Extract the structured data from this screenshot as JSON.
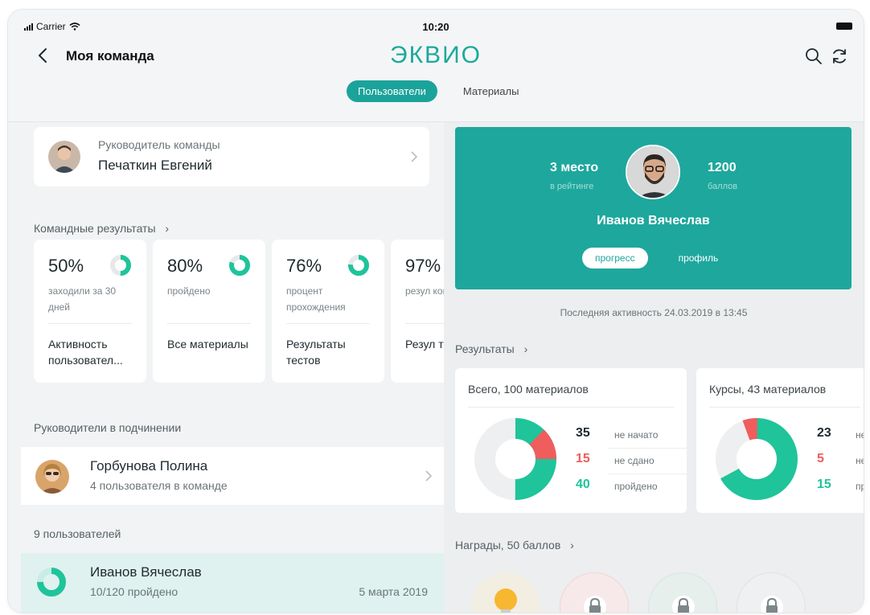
{
  "status": {
    "carrier": "Carrier",
    "time": "10:20"
  },
  "header": {
    "title": "Моя команда",
    "logo": "ЭКВИО",
    "tabs": [
      {
        "label": "Пользователи",
        "active": true
      },
      {
        "label": "Материалы",
        "active": false
      }
    ]
  },
  "lead": {
    "subtitle": "Руководитель команды",
    "name": "Печаткин Евгений"
  },
  "team_results": {
    "label": "Командные результаты",
    "cards": [
      {
        "value": "50%",
        "desc": "заходили за 30 дней",
        "title": "Активность пользовател..."
      },
      {
        "value": "80%",
        "desc": "пройдено",
        "title": "Все материалы"
      },
      {
        "value": "76%",
        "desc": "процент прохождения",
        "title": "Результаты тестов"
      },
      {
        "value": "97%",
        "desc": "резул коман",
        "title": "Резул тестов"
      }
    ]
  },
  "subordinates": {
    "label": "Руководители в подчинении",
    "item": {
      "name": "Горбунова Полина",
      "meta": "4 пользователя в команде"
    }
  },
  "users": {
    "count_label": "9 пользователей",
    "selected": {
      "name": "Иванов Вячеслав",
      "progress_text": "10/120 пройдено",
      "date": "5 марта 2019"
    }
  },
  "profile": {
    "rank_value": "3 место",
    "rank_caption": "в рейтинге",
    "points_value": "1200",
    "points_caption": "баллов",
    "name": "Иванов Вячеслав",
    "tabs": [
      {
        "label": "прогресс",
        "active": true
      },
      {
        "label": "профиль",
        "active": false
      }
    ],
    "last_activity": "Последняя активность 24.03.2019 в 13:45"
  },
  "results": {
    "label": "Результаты",
    "cards": [
      {
        "title": "Всего, 100 материалов",
        "rows": [
          {
            "num": "35",
            "label": "не начато",
            "color": "#1f2a2e"
          },
          {
            "num": "15",
            "label": "не сдано",
            "color": "#ef5d5d"
          },
          {
            "num": "40",
            "label": "пройдено",
            "color": "#1fc49a"
          }
        ]
      },
      {
        "title": "Курсы, 43 материалов",
        "rows": [
          {
            "num": "23",
            "label": "не",
            "color": "#1f2a2e"
          },
          {
            "num": "5",
            "label": "не",
            "color": "#ef5d5d"
          },
          {
            "num": "15",
            "label": "пр",
            "color": "#1fc49a"
          }
        ]
      }
    ]
  },
  "awards": {
    "label": "Награды, 50 баллов"
  },
  "colors": {
    "accent": "#1aa39a",
    "green": "#1fc49a",
    "red": "#ef5d5d",
    "selected_row": "#dff2f0"
  },
  "icons": [
    "back-icon",
    "search-icon",
    "refresh-icon",
    "chevron-right-icon",
    "lightbulb-icon",
    "lock-icon"
  ]
}
